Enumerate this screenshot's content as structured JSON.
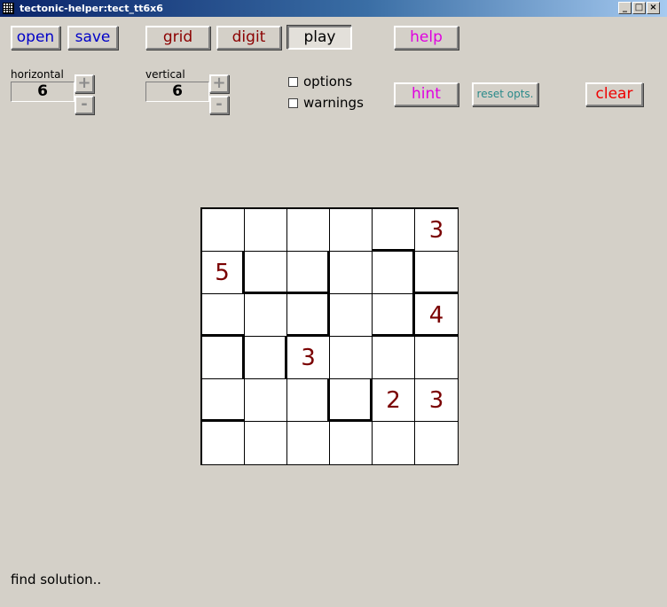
{
  "window": {
    "title": "tectonic-helper:tect_tt6x6",
    "controls": [
      "_",
      "□",
      "×"
    ]
  },
  "toolbar": {
    "open": "open",
    "save": "save",
    "grid": "grid",
    "digit": "digit",
    "play": "play",
    "help": "help",
    "hint": "hint",
    "reset_opts": "reset opts.",
    "clear": "clear"
  },
  "colors": {
    "blue": "#0000c8",
    "darkred": "#8b0000",
    "magenta": "#e000e0",
    "teal": "#2a8a8a",
    "red": "#ee0000",
    "digit": "#7a0000"
  },
  "horizontal": {
    "label": "horizontal",
    "value": "6",
    "plus": "+",
    "minus": "-"
  },
  "vertical": {
    "label": "vertical",
    "value": "6",
    "plus": "+",
    "minus": "-"
  },
  "checkboxes": {
    "options": "options",
    "warnings": "warnings"
  },
  "puzzle": {
    "rows": 6,
    "cols": 6,
    "cells": [
      [
        "",
        "",
        "",
        "",
        "",
        "3"
      ],
      [
        "5",
        "",
        "",
        "",
        "",
        ""
      ],
      [
        "",
        "",
        "",
        "",
        "",
        "4"
      ],
      [
        "",
        "",
        "3",
        "",
        "",
        ""
      ],
      [
        "",
        "",
        "",
        "",
        "2",
        "3"
      ],
      [
        "",
        "",
        "",
        "",
        "",
        ""
      ]
    ],
    "thick_right": [
      [
        0,
        0,
        0,
        0,
        0,
        0
      ],
      [
        1,
        0,
        1,
        0,
        1,
        0
      ],
      [
        0,
        0,
        1,
        0,
        1,
        0
      ],
      [
        1,
        1,
        0,
        0,
        0,
        0
      ],
      [
        0,
        0,
        1,
        1,
        0,
        0
      ],
      [
        0,
        0,
        0,
        0,
        0,
        0
      ]
    ],
    "thick_bottom": [
      [
        0,
        0,
        0,
        0,
        1,
        0
      ],
      [
        0,
        1,
        1,
        0,
        0,
        1
      ],
      [
        1,
        0,
        1,
        0,
        1,
        1
      ],
      [
        0,
        0,
        0,
        0,
        0,
        0
      ],
      [
        1,
        0,
        0,
        1,
        0,
        0
      ],
      [
        0,
        0,
        0,
        0,
        0,
        0
      ]
    ]
  },
  "status": "find solution.."
}
